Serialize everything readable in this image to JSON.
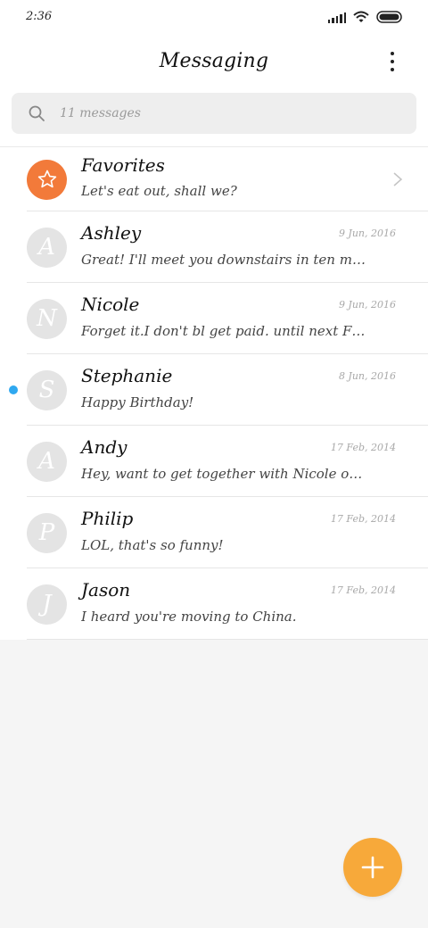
{
  "status_bar": {
    "time": "2:36",
    "icons": [
      "signal-icon",
      "wifi-icon",
      "battery-icon"
    ]
  },
  "header": {
    "title": "Messaging",
    "menu_icon": "more-vertical-icon"
  },
  "search": {
    "placeholder": "11 messages",
    "icon": "search-icon"
  },
  "favorites": {
    "name": "Favorites",
    "preview": "Let's eat out, shall we?",
    "icon": "star-icon",
    "color": "#f27a3a"
  },
  "conversations": [
    {
      "initial": "A",
      "name": "Ashley",
      "preview": "Great! I'll meet you downstairs in ten min...",
      "date": "9 Jun, 2016",
      "unread": false
    },
    {
      "initial": "N",
      "name": "Nicole",
      "preview": "Forget it.I don't bl get paid. until next Fri...",
      "date": "9 Jun, 2016",
      "unread": false
    },
    {
      "initial": "S",
      "name": "Stephanie",
      "preview": "Happy Birthday!",
      "date": "8 Jun, 2016",
      "unread": true
    },
    {
      "initial": "A",
      "name": "Andy",
      "preview": "Hey, want to get together with Nicole on...",
      "date": "17 Feb, 2014",
      "unread": false
    },
    {
      "initial": "P",
      "name": "Philip",
      "preview": "LOL, that's so funny!",
      "date": "17 Feb, 2014",
      "unread": false
    },
    {
      "initial": "J",
      "name": "Jason",
      "preview": "I heard you're moving to China.",
      "date": "17 Feb, 2014",
      "unread": false
    }
  ],
  "fab": {
    "icon": "plus-icon",
    "color": "#f7a93a"
  },
  "colors": {
    "unread_dot": "#2fa8f0",
    "avatar_bg": "#e4e4e4",
    "background": "#f5f5f5"
  }
}
